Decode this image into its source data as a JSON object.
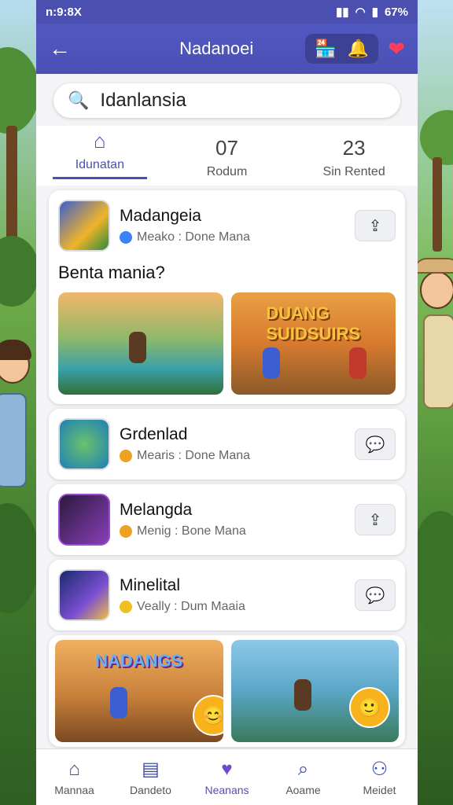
{
  "status": {
    "time": "n:9:8X",
    "battery": "67%"
  },
  "header": {
    "title": "Nadanoei"
  },
  "search": {
    "value": "Idanlansia"
  },
  "tabs": [
    {
      "top_icon": "home-icon",
      "label": "Idunatan"
    },
    {
      "top": "07",
      "label": "Rodum"
    },
    {
      "top": "23",
      "label": "Sin Rented"
    }
  ],
  "featured": {
    "name": "Madangeia",
    "meta": "Meako : Done Mana",
    "question": "Benta mania?",
    "shot2_title": "DUANG SUIDSUIRS"
  },
  "list": [
    {
      "name": "Grdenlad",
      "meta": "Mearis : Done Mana"
    },
    {
      "name": "Melangda",
      "meta": "Menig : Bone Mana"
    },
    {
      "name": "Minelital",
      "meta": "Veally : Dum Maaia"
    }
  ],
  "bottom_card": {
    "title": "NADANGS"
  },
  "bottom_nav": [
    {
      "label": "Mannaa",
      "icon": "home-icon"
    },
    {
      "label": "Dandeto",
      "icon": "news-icon"
    },
    {
      "label": "Neanans",
      "icon": "heart-icon"
    },
    {
      "label": "Aoame",
      "icon": "search-icon"
    },
    {
      "label": "Meidet",
      "icon": "people-icon"
    }
  ],
  "colors": {
    "primary": "#4a50b6",
    "accent": "#ff3d5a"
  }
}
